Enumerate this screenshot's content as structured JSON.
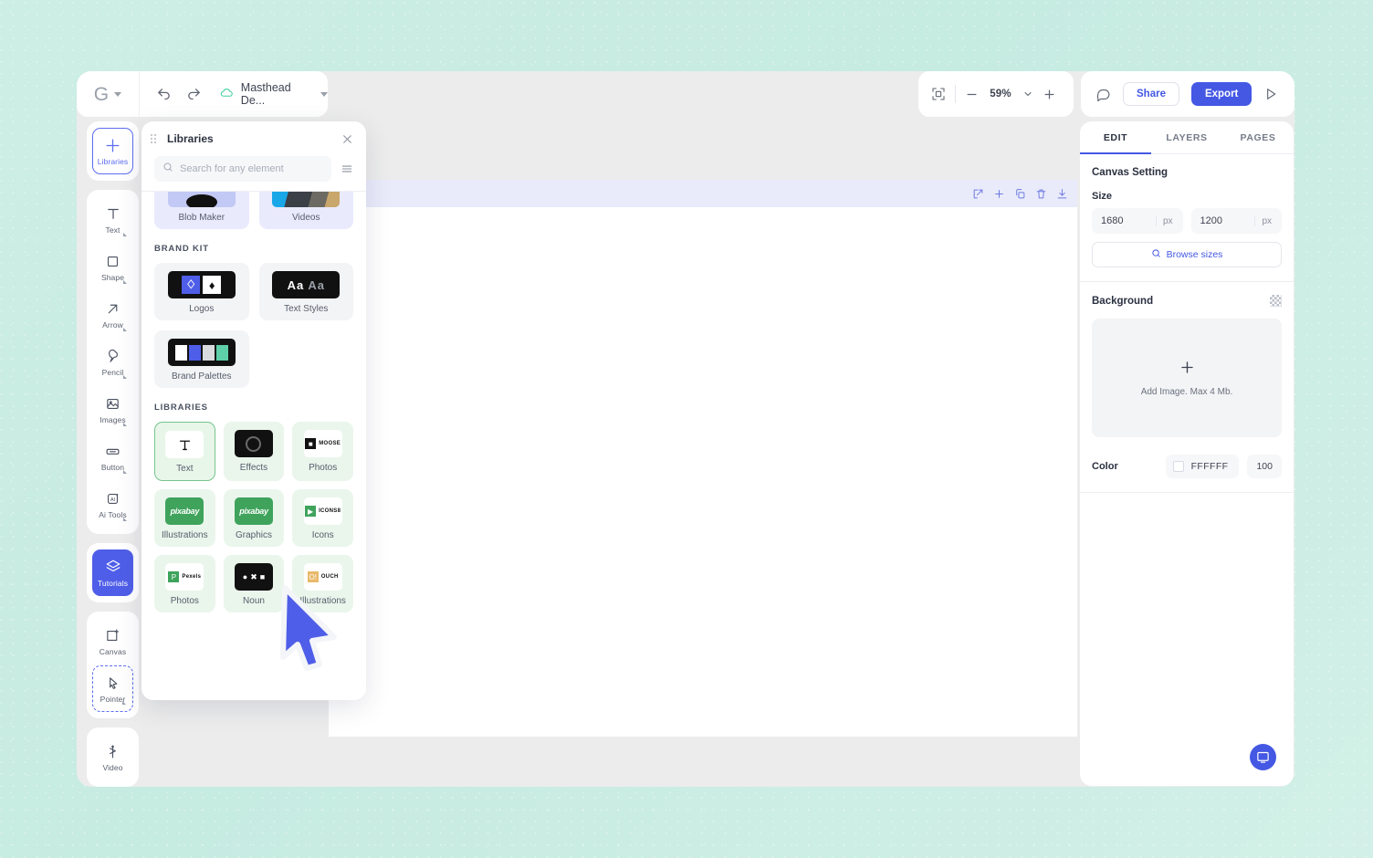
{
  "app": {
    "logo": "G",
    "document_name": "Masthead De...",
    "zoom_level": "59%",
    "share_label": "Share",
    "export_label": "Export"
  },
  "toolrail": {
    "groups": [
      {
        "items": [
          {
            "label": "Libraries",
            "icon": "plus-icon",
            "state": "selected",
            "submenu": false
          }
        ]
      },
      {
        "items": [
          {
            "label": "Text",
            "icon": "text-icon",
            "state": "normal",
            "submenu": true
          },
          {
            "label": "Shape",
            "icon": "square-icon",
            "state": "normal",
            "submenu": true
          },
          {
            "label": "Arrow",
            "icon": "arrow-icon",
            "state": "normal",
            "submenu": true
          },
          {
            "label": "Pencil",
            "icon": "pencil-icon",
            "state": "normal",
            "submenu": true
          },
          {
            "label": "Images",
            "icon": "image-icon",
            "state": "normal",
            "submenu": true
          },
          {
            "label": "Button",
            "icon": "button-icon",
            "state": "normal",
            "submenu": true
          },
          {
            "label": "Ai Tools",
            "icon": "ai-icon",
            "state": "normal",
            "submenu": true
          }
        ]
      },
      {
        "items": [
          {
            "label": "Tutorials",
            "icon": "layers-icon",
            "state": "filled",
            "submenu": false
          }
        ]
      },
      {
        "items": [
          {
            "label": "Canvas",
            "icon": "canvas-icon",
            "state": "normal",
            "submenu": false
          },
          {
            "label": "Pointer",
            "icon": "pointer-icon",
            "state": "dashed",
            "submenu": true
          }
        ]
      },
      {
        "items": [
          {
            "label": "Video",
            "icon": "video-icon",
            "state": "normal",
            "submenu": false
          }
        ]
      }
    ]
  },
  "libraries_panel": {
    "title": "Libraries",
    "search_placeholder": "Search for any element",
    "top_cards": [
      {
        "label": "Blob Maker",
        "thumb": "blob",
        "tone": "violet"
      },
      {
        "label": "Videos",
        "thumb": "video",
        "tone": "violet"
      }
    ],
    "brand_kit": {
      "heading": "BRAND KIT",
      "cards": [
        {
          "label": "Logos",
          "thumb": "logos",
          "tone": "grey"
        },
        {
          "label": "Text Styles",
          "thumb": "aa",
          "tone": "grey",
          "thumb_text": "Aa",
          "thumb_text2": "Aa"
        },
        {
          "label": "Brand Palettes",
          "thumb": "palette",
          "tone": "grey"
        }
      ]
    },
    "libraries": {
      "heading": "LIBRARIES",
      "cards": [
        {
          "label": "Text",
          "thumb": "text",
          "tone": "green",
          "selected": true
        },
        {
          "label": "Effects",
          "thumb": "effects",
          "tone": "green",
          "selected": false
        },
        {
          "label": "Photos",
          "thumb": "moose",
          "tone": "green",
          "selected": false,
          "brand": "MOOSE"
        },
        {
          "label": "Illustrations",
          "thumb": "pixabay",
          "tone": "green",
          "selected": false,
          "brand": "pixabay"
        },
        {
          "label": "Graphics",
          "thumb": "pixabay",
          "tone": "green",
          "selected": false,
          "brand": "pixabay"
        },
        {
          "label": "Icons",
          "thumb": "icons8",
          "tone": "green",
          "selected": false,
          "brand": "ICONS8"
        },
        {
          "label": "Photos",
          "thumb": "pexels",
          "tone": "green",
          "selected": false,
          "brand": "Pexels"
        },
        {
          "label": "Noun",
          "thumb": "noun",
          "tone": "green",
          "selected": false
        },
        {
          "label": "Illustrations",
          "thumb": "ouch",
          "tone": "green",
          "selected": false,
          "brand": "OUCH"
        }
      ]
    }
  },
  "artboard": {
    "toolbar_icons": [
      "edit-icon",
      "plus-icon",
      "duplicate-icon",
      "trash-icon",
      "download-icon"
    ]
  },
  "inspector": {
    "tabs": [
      {
        "label": "EDIT",
        "active": true
      },
      {
        "label": "LAYERS",
        "active": false
      },
      {
        "label": "PAGES",
        "active": false
      }
    ],
    "canvas_setting_title": "Canvas Setting",
    "size_label": "Size",
    "width_value": "1680",
    "height_value": "1200",
    "unit": "px",
    "browse_sizes": "Browse sizes",
    "background_label": "Background",
    "dropzone_text": "Add Image. Max 4 Mb.",
    "color_label": "Color",
    "color_hex": "FFFFFF",
    "color_opacity": "100"
  },
  "colors": {
    "accent": "#4458e4",
    "page_bg": "#c9ece3",
    "artboard_bar": "#e9ebfb",
    "green_tone": "#eaf6ec",
    "violet_tone": "#e9eafc"
  }
}
